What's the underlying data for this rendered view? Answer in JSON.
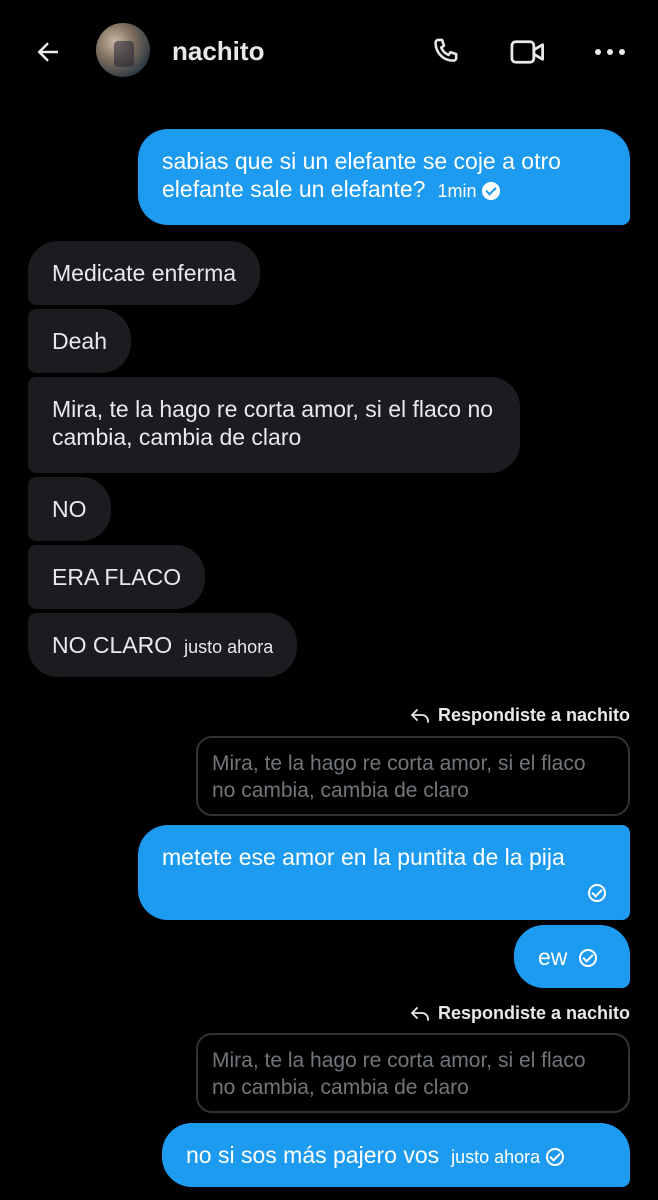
{
  "header": {
    "title": "nachito",
    "icons": [
      "back-arrow-icon",
      "avatar",
      "phone-icon",
      "video-icon",
      "more-icon"
    ]
  },
  "messages": [
    {
      "side": "out",
      "text": "sabias que si un elefante se coje a otro elefante sale un elefante?",
      "time": "1min",
      "status": "read"
    },
    {
      "side": "in",
      "text": "Medicate enferma"
    },
    {
      "side": "in",
      "text": "Deah"
    },
    {
      "side": "in",
      "text": "Mira, te la hago re corta amor, si el flaco no cambia, cambia de claro"
    },
    {
      "side": "in",
      "text": "NO"
    },
    {
      "side": "in",
      "text": "ERA FLACO"
    },
    {
      "side": "in",
      "text": "NO CLARO",
      "time": "justo ahora"
    },
    {
      "side": "out",
      "reply_label": "Respondiste a nachito",
      "quote": "Mira, te la hago re corta amor, si el flaco no cambia, cambia de claro",
      "text": "metete ese amor en la puntita de la pija",
      "status": "sent"
    },
    {
      "side": "out",
      "text": "ew",
      "status": "sent"
    },
    {
      "side": "out",
      "reply_label": "Respondiste a nachito",
      "quote": "Mira, te la hago re corta amor, si el flaco no cambia, cambia de claro",
      "text": "no si sos más pajero vos",
      "time": "justo ahora",
      "status": "sent"
    }
  ],
  "colors": {
    "background": "#000000",
    "outgoing_bubble": "#1d9bf0",
    "incoming_bubble": "#1a1c1f",
    "text_primary": "#e7e9ea",
    "text_secondary": "#71767b"
  }
}
